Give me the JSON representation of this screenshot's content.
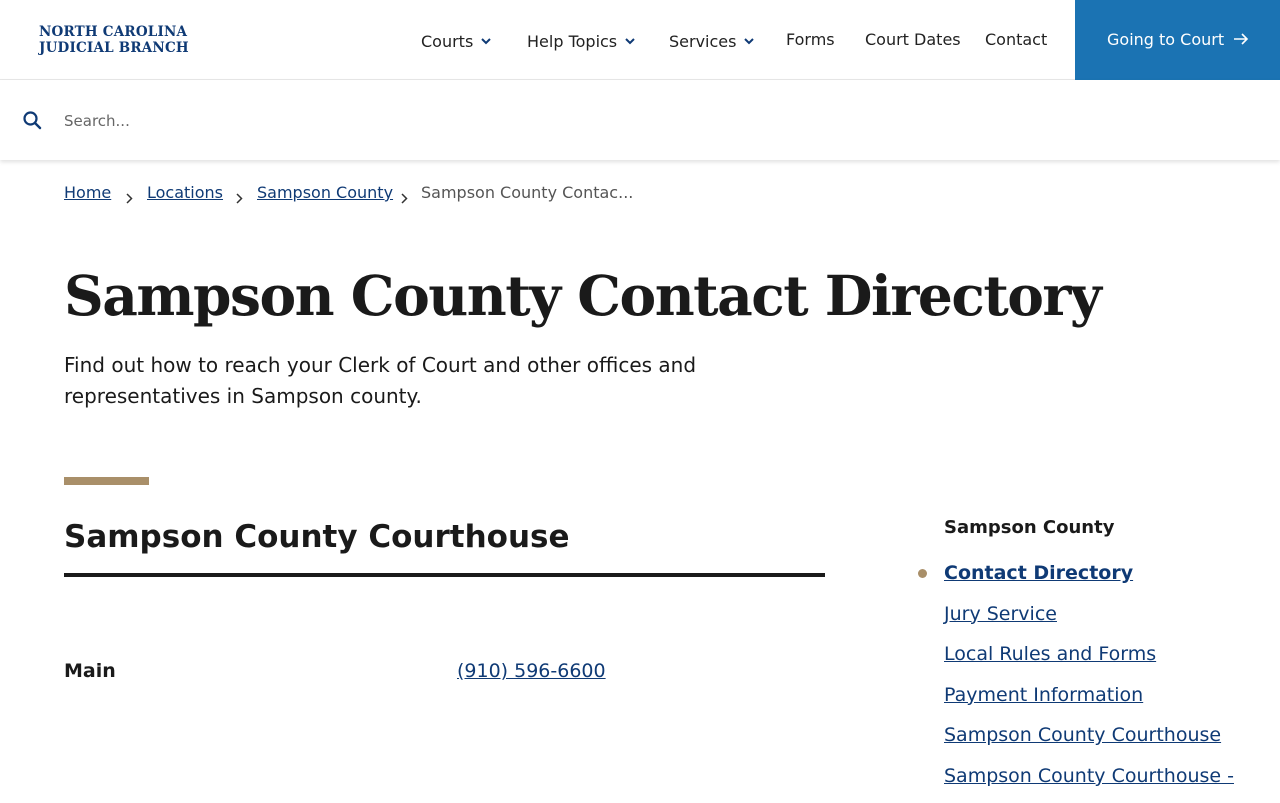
{
  "header": {
    "logo_line1": "NORTH CAROLINA",
    "logo_line2": "JUDICIAL BRANCH",
    "nav": [
      {
        "label": "Courts"
      },
      {
        "label": "Help Topics"
      },
      {
        "label": "Services"
      },
      {
        "label": "Forms"
      },
      {
        "label": "Court Dates"
      },
      {
        "label": "Contact"
      }
    ],
    "cta_label": "Going to Court"
  },
  "search": {
    "placeholder": "Search..."
  },
  "breadcrumb": [
    {
      "label": "Home"
    },
    {
      "label": "Locations"
    },
    {
      "label": "Sampson County"
    },
    {
      "label": "Sampson County Contac..."
    }
  ],
  "page": {
    "title": "Sampson County Contact Directory",
    "intro": "Find out how to reach your Clerk of Court and other offices and representatives in Sampson county."
  },
  "section": {
    "heading": "Sampson County Courthouse",
    "rows": [
      {
        "label": "Main",
        "phone": "(910) 596-6600"
      }
    ]
  },
  "sidebar": {
    "title": "Sampson County",
    "items": [
      {
        "label": "Contact Directory"
      },
      {
        "label": "Jury Service"
      },
      {
        "label": "Local Rules and Forms"
      },
      {
        "label": "Payment Information"
      },
      {
        "label": "Sampson County Courthouse"
      },
      {
        "label": "Sampson County Courthouse -"
      }
    ]
  },
  "colors": {
    "brand_navy": "#0f3a75",
    "cta_blue": "#1b73b3",
    "accent_tan": "#a98f69"
  },
  "icons": [
    "chevron-down-icon",
    "arrow-right-icon",
    "search-icon",
    "chevron-right-icon",
    "bullet-dot-icon"
  ]
}
